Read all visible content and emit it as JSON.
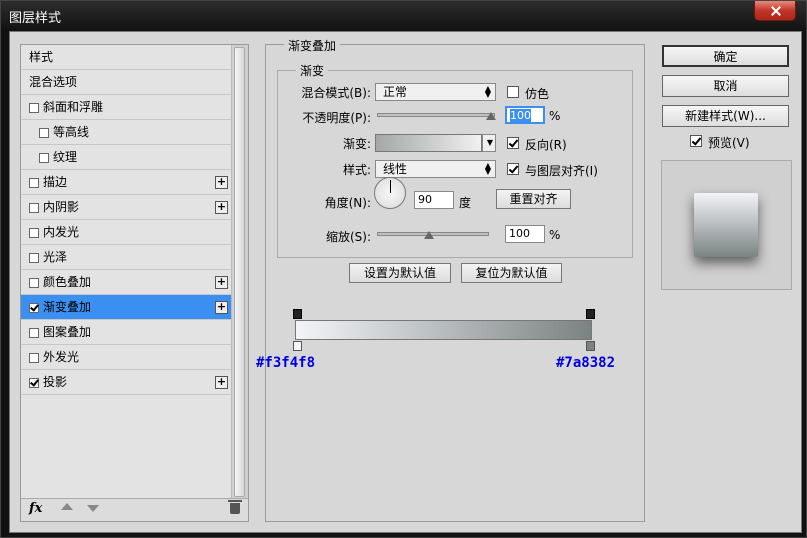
{
  "window": {
    "title": "图层样式"
  },
  "sidebar": {
    "items": [
      {
        "label": "样式",
        "checkbox": false,
        "checked": false,
        "plus": false,
        "indent": false,
        "selected": false
      },
      {
        "label": "混合选项",
        "checkbox": false,
        "checked": false,
        "plus": false,
        "indent": false,
        "selected": false
      },
      {
        "label": "斜面和浮雕",
        "checkbox": true,
        "checked": false,
        "plus": false,
        "indent": false,
        "selected": false
      },
      {
        "label": "等高线",
        "checkbox": true,
        "checked": false,
        "plus": false,
        "indent": true,
        "selected": false
      },
      {
        "label": "纹理",
        "checkbox": true,
        "checked": false,
        "plus": false,
        "indent": true,
        "selected": false
      },
      {
        "label": "描边",
        "checkbox": true,
        "checked": false,
        "plus": true,
        "indent": false,
        "selected": false
      },
      {
        "label": "内阴影",
        "checkbox": true,
        "checked": false,
        "plus": true,
        "indent": false,
        "selected": false
      },
      {
        "label": "内发光",
        "checkbox": true,
        "checked": false,
        "plus": false,
        "indent": false,
        "selected": false
      },
      {
        "label": "光泽",
        "checkbox": true,
        "checked": false,
        "plus": false,
        "indent": false,
        "selected": false
      },
      {
        "label": "颜色叠加",
        "checkbox": true,
        "checked": false,
        "plus": true,
        "indent": false,
        "selected": false
      },
      {
        "label": "渐变叠加",
        "checkbox": true,
        "checked": true,
        "plus": true,
        "indent": false,
        "selected": true
      },
      {
        "label": "图案叠加",
        "checkbox": true,
        "checked": false,
        "plus": false,
        "indent": false,
        "selected": false
      },
      {
        "label": "外发光",
        "checkbox": true,
        "checked": false,
        "plus": false,
        "indent": false,
        "selected": false
      },
      {
        "label": "投影",
        "checkbox": true,
        "checked": true,
        "plus": true,
        "indent": false,
        "selected": false
      }
    ],
    "footer": {
      "fx_label": "fx"
    }
  },
  "panel": {
    "section_title": "渐变叠加",
    "group_title": "渐变",
    "blend_mode": {
      "label": "混合模式(B):",
      "value": "正常"
    },
    "dither": {
      "label": "仿色",
      "checked": false
    },
    "opacity": {
      "label": "不透明度(P):",
      "value": "100",
      "unit": "%",
      "level": 1.0
    },
    "gradient": {
      "label": "渐变:",
      "start_color": "#a3a7a6",
      "end_color": "#f0f1f2"
    },
    "reverse": {
      "label": "反向(R)",
      "checked": true
    },
    "style": {
      "label": "样式:",
      "value": "线性"
    },
    "align": {
      "label": "与图层对齐(I)",
      "checked": true
    },
    "angle": {
      "label": "角度(N):",
      "value": "90",
      "unit": "度"
    },
    "reset_align": "重置对齐",
    "scale": {
      "label": "缩放(S):",
      "value": "100",
      "unit": "%",
      "level": 0.45
    },
    "make_default": "设置为默认值",
    "reset_default": "复位为默认值"
  },
  "gradient_editor": {
    "start_hex": "#f3f4f8",
    "end_hex": "#7a8382",
    "start_color": "#f3f4f8",
    "end_color": "#7a8382"
  },
  "buttons": {
    "ok": "确定",
    "cancel": "取消",
    "new_style": "新建样式(W)...",
    "preview": {
      "label": "预览(V)",
      "checked": true
    }
  },
  "colors": {
    "selected": "#3b8ff1",
    "annotation": "#0000dd"
  }
}
